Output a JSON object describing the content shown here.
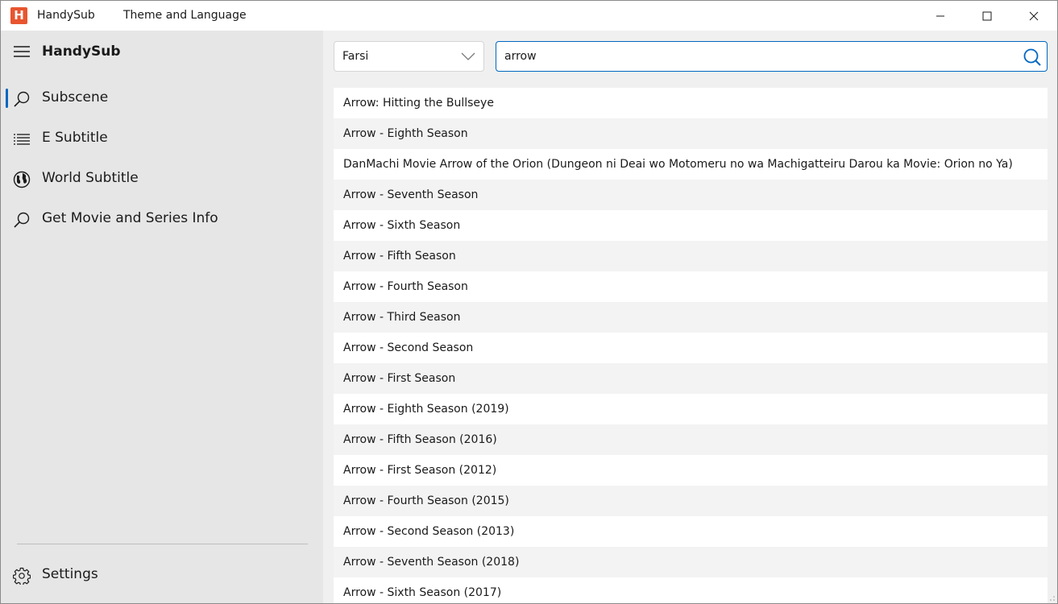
{
  "titlebar": {
    "app_logo_letter": "H",
    "app_name": "HandySub",
    "window_title": "Theme and Language",
    "icons": {
      "minimize": "minimize-icon",
      "maximize": "maximize-icon",
      "close": "close-icon"
    }
  },
  "sidebar": {
    "title": "HandySub",
    "items": [
      {
        "label": "Subscene",
        "icon": "search-icon",
        "selected": true
      },
      {
        "label": "E Subtitle",
        "icon": "list-icon",
        "selected": false
      },
      {
        "label": "World Subtitle",
        "icon": "globe-icon",
        "selected": false
      },
      {
        "label": "Get Movie and Series Info",
        "icon": "search-icon",
        "selected": false
      }
    ],
    "settings_label": "Settings"
  },
  "toolbar": {
    "language": "Farsi",
    "search_value": "arrow"
  },
  "results": [
    "Arrow: Hitting the Bullseye",
    "Arrow - Eighth Season",
    "DanMachi Movie Arrow of the Orion (Dungeon ni Deai wo Motomeru no wa Machigatteiru Darou ka Movie: Orion no Ya)",
    "Arrow - Seventh Season",
    "Arrow - Sixth Season",
    "Arrow - Fifth Season",
    "Arrow - Fourth Season",
    "Arrow - Third Season",
    "Arrow - Second Season",
    "Arrow - First Season",
    "Arrow - Eighth Season (2019)",
    "Arrow - Fifth Season (2016)",
    "Arrow - First Season (2012)",
    "Arrow - Fourth Season (2015)",
    "Arrow - Second Season (2013)",
    "Arrow - Seventh Season (2018)",
    "Arrow - Sixth Season (2017)"
  ],
  "colors": {
    "accent": "#0067c0",
    "logo": "#e8552f",
    "sidebar_bg": "#e6e6e6",
    "main_bg": "#f0f0f0"
  }
}
